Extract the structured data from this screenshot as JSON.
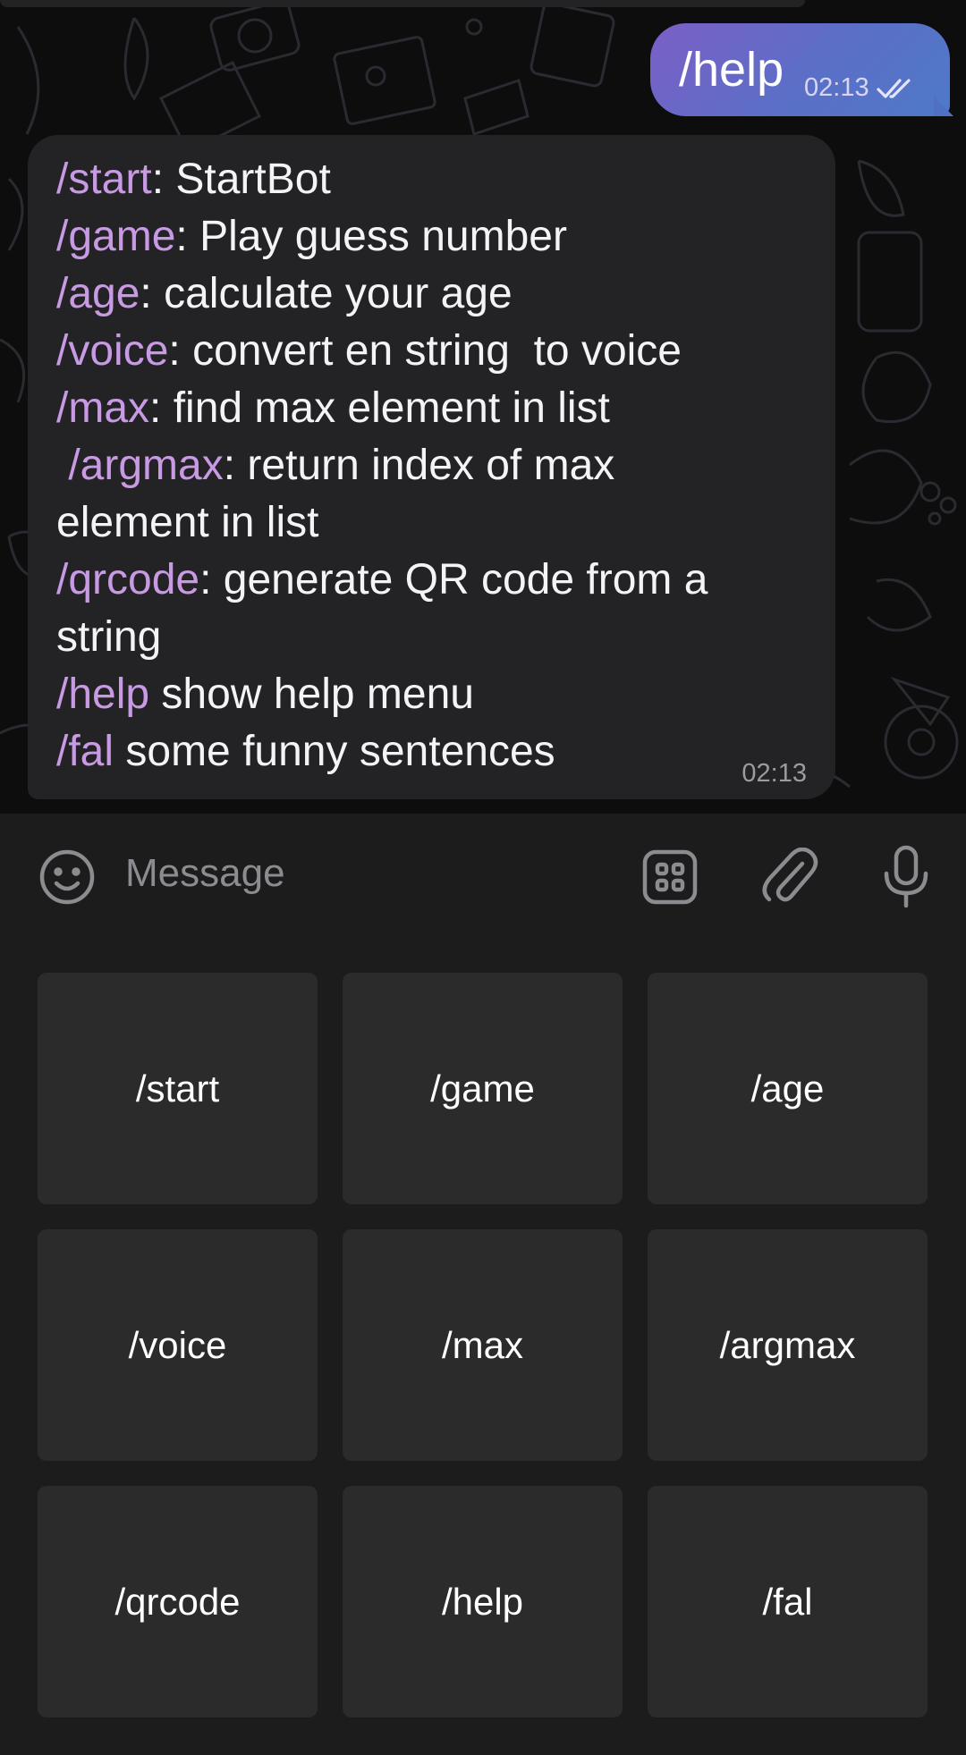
{
  "outgoing": {
    "text": "/help",
    "time": "02:13",
    "status_icon": "double-check-icon"
  },
  "incoming": {
    "time": "02:13",
    "lines": [
      {
        "cmd": "/start",
        "rest": ": StartBot"
      },
      {
        "cmd": "/game",
        "rest": ": Play guess number"
      },
      {
        "cmd": "/age",
        "rest": ": calculate your age"
      },
      {
        "cmd": "/voice",
        "rest": ": convert en string  to voice"
      },
      {
        "cmd": "/max",
        "rest": ": find max element in list"
      },
      {
        "pre": " ",
        "cmd": "/argmax",
        "rest": ": return index of max"
      },
      {
        "rest": "element in list"
      },
      {
        "cmd": "/qrcode",
        "rest": ": generate QR code from a"
      },
      {
        "rest": "string"
      },
      {
        "cmd": "/help",
        "rest": " show help menu"
      },
      {
        "cmd": "/fal",
        "rest": " some funny sentences"
      }
    ]
  },
  "input": {
    "placeholder": "Message",
    "icons": [
      "emoji-icon",
      "bot-keyboard-icon",
      "attach-icon",
      "microphone-icon"
    ]
  },
  "keyboard": {
    "buttons": [
      "/start",
      "/game",
      "/age",
      "/voice",
      "/max",
      "/argmax",
      "/qrcode",
      "/help",
      "/fal"
    ]
  },
  "colors": {
    "command": "#c99ae4",
    "outgoing_bubble": "#5a6fc7",
    "incoming_bubble": "#232326",
    "key_background": "#2b2b2c"
  }
}
